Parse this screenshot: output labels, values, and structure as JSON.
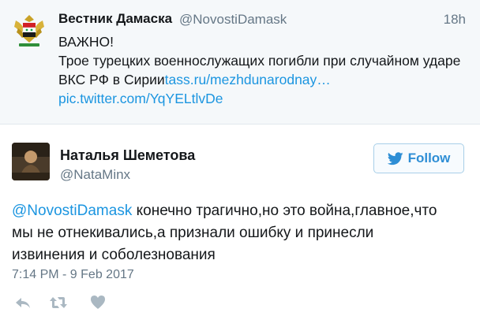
{
  "quoted_tweet": {
    "author_name": "Вестник Дамаска",
    "author_handle": "@NovostiDamask",
    "time": "18h",
    "text_line1": "ВАЖНО!",
    "text_line2": "Трое турецких военнослужащих погибли при случайном ударе",
    "text_line3_plain": "ВКС РФ в Сирии",
    "text_line3_link": "tass.ru/mezhdunarodnay…",
    "text_line4_link": "pic.twitter.com/YqYELtlvDe",
    "avatar_icon": "syria-coat-of-arms-icon"
  },
  "reply_tweet": {
    "author_name": "Наталья Шеметова",
    "author_handle": "@NataMinx",
    "follow_label": "Follow",
    "mention": "@NovostiDamask",
    "text_line1_rest": " конечно трагично,но это война,главное,что",
    "text_line2": "мы не отнекивались,а признали ошибку и принесли",
    "text_line3": "извинения и соболезнования",
    "timestamp": "7:14 PM - 9 Feb 2017",
    "avatar_icon": "user-photo-avatar"
  },
  "actions": {
    "reply_icon": "reply-icon",
    "retweet_icon": "retweet-icon",
    "like_icon": "heart-icon"
  },
  "colors": {
    "link": "#1b95e0",
    "secondary": "#657786",
    "quoted_bg": "#f5f8fa",
    "follow": "#2e8ed5"
  }
}
